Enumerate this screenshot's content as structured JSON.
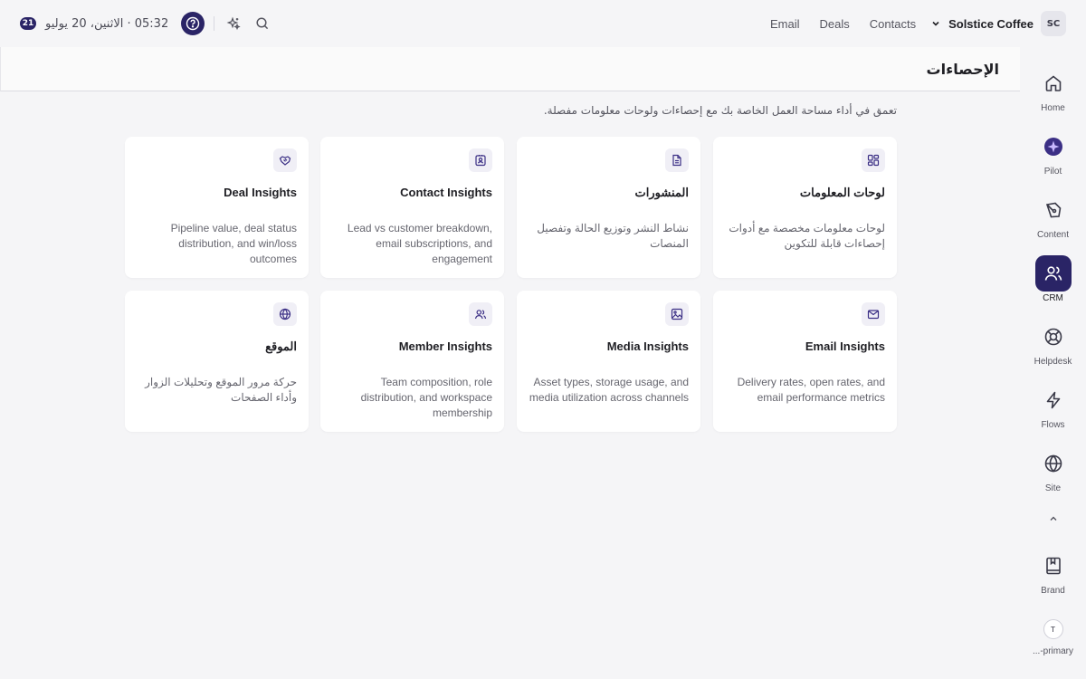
{
  "topbar": {
    "notification_count": "21",
    "datetime": "05:32 · الاثنين، 20 يوليو",
    "nav": [
      "Email",
      "Deals",
      "Contacts"
    ],
    "workspace_name": "Solstice Coffee",
    "workspace_initials": "SC"
  },
  "page": {
    "title": "الإحصاءات",
    "description": "تعمق في أداء مساحة العمل الخاصة بك مع إحصاءات ولوحات معلومات مفصلة."
  },
  "cards": [
    {
      "title": "لوحات المعلومات",
      "desc": "لوحات معلومات مخصصة مع أدوات إحصاءات قابلة للتكوين",
      "icon": "dashboard-icon"
    },
    {
      "title": "المنشورات",
      "desc": "نشاط النشر وتوزيع الحالة وتفصيل المنصات",
      "icon": "document-icon"
    },
    {
      "title": "Contact Insights",
      "desc": "Lead vs customer breakdown, email subscriptions, and engagement",
      "icon": "contact-card-icon"
    },
    {
      "title": "Deal Insights",
      "desc": "Pipeline value, deal status distribution, and win/loss outcomes",
      "icon": "handshake-icon"
    },
    {
      "title": "Email Insights",
      "desc": "Delivery rates, open rates, and email performance metrics",
      "icon": "mail-icon"
    },
    {
      "title": "Media Insights",
      "desc": "Asset types, storage usage, and media utilization across channels",
      "icon": "image-icon"
    },
    {
      "title": "Member Insights",
      "desc": "Team composition, role distribution, and workspace membership",
      "icon": "users-icon"
    },
    {
      "title": "الموقع",
      "desc": "حركة مرور الموقع وتحليلات الزوار وأداء الصفحات",
      "icon": "globe-icon"
    }
  ],
  "sidebar": {
    "items": [
      {
        "label": "Home",
        "icon": "home-icon"
      },
      {
        "label": "Pilot",
        "icon": "pilot-icon"
      },
      {
        "label": "Content",
        "icon": "pen-icon"
      },
      {
        "label": "CRM",
        "icon": "users-icon",
        "active": true
      },
      {
        "label": "Helpdesk",
        "icon": "lifebuoy-icon"
      },
      {
        "label": "Flows",
        "icon": "bolt-icon"
      },
      {
        "label": "Site",
        "icon": "globe-icon"
      }
    ],
    "brand_label": "Brand",
    "profile_initial": "T",
    "profile_label": "...-primary"
  },
  "colors": {
    "accent": "#2a2466",
    "background": "#f5f5f7",
    "card": "#ffffff",
    "icon_tile": "#f0eff6"
  }
}
